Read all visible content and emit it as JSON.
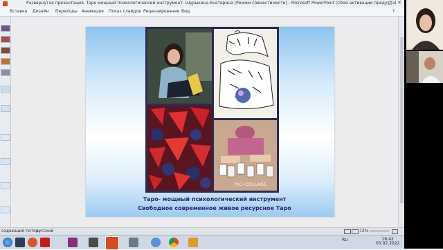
{
  "window": {
    "title": "Развернутая презентация. Таро мощный психологический инструмент. Шурыкина Екатерина [Режим совместимости] - Microsoft PowerPoint (Сбой активации продукта)",
    "controls": [
      "–",
      "□",
      "✕"
    ]
  },
  "ribbon": {
    "tabs": [
      "Вставка",
      "Дизайн",
      "Переходы",
      "Анимация",
      "Показ слайдов",
      "Рецензирование",
      "Вид"
    ]
  },
  "slide": {
    "caption_line1": "Таро- мощный психологический инструмент",
    "caption_line2": "Свободное современное живое ресурсное Таро",
    "collage_watermark": "PIC•COLLAGE"
  },
  "status": {
    "left_text": "оздающий поток:",
    "language": "русский",
    "zoom": "72%"
  },
  "tray": {
    "language": "RU",
    "time": "16:42",
    "date": "05.02.2022"
  },
  "colors": {
    "accent": "#2d1f6b",
    "collage_border": "#2c2b52",
    "slide_gradient_top": "#8fc3ef"
  }
}
